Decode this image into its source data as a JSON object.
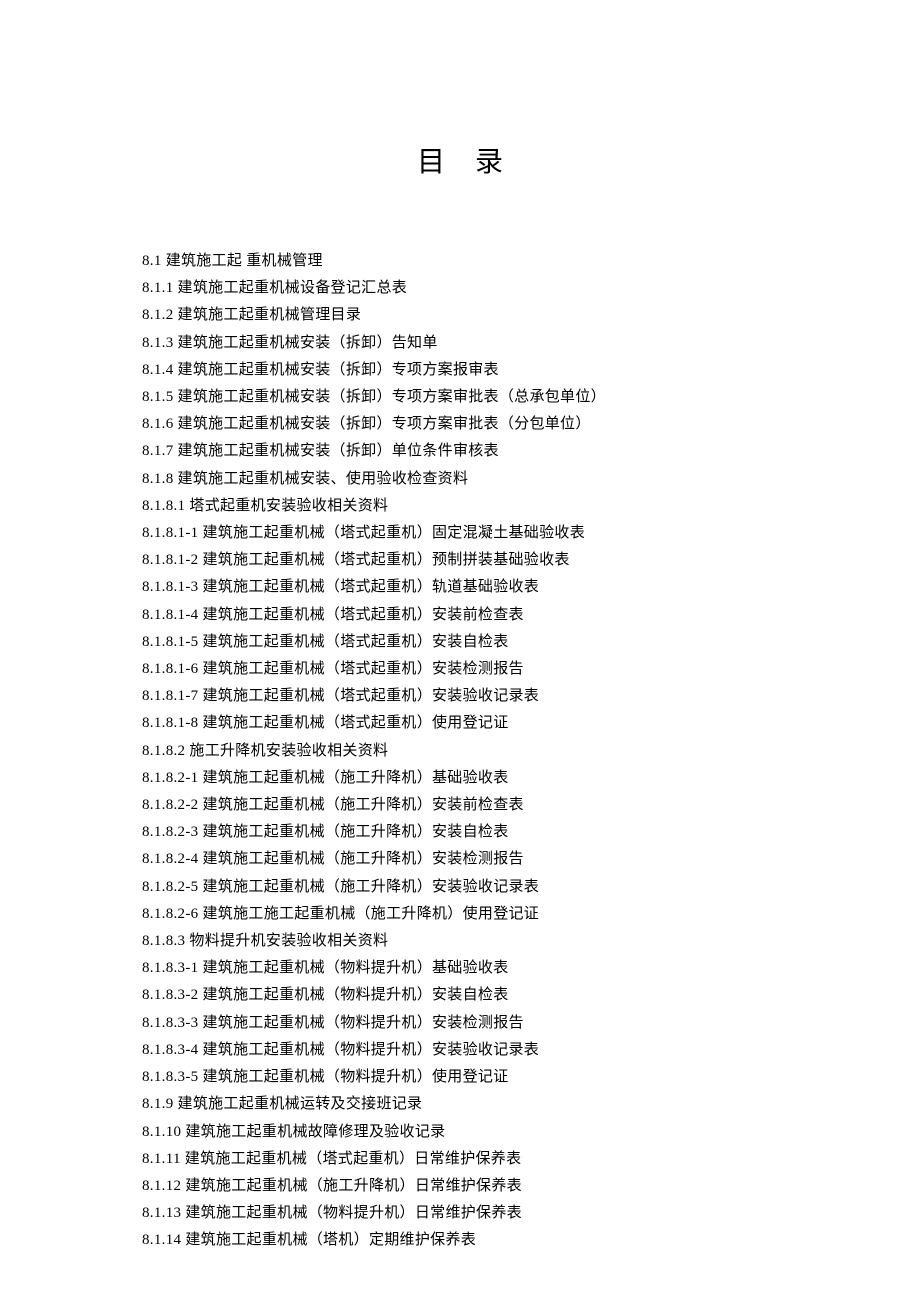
{
  "title": "目录",
  "toc": [
    "8.1  建筑施工起  重机械管理",
    "8.1.1  建筑施工起重机械设备登记汇总表",
    "8.1.2  建筑施工起重机械管理目录",
    "8.1.3  建筑施工起重机械安装（拆卸）告知单",
    "8.1.4  建筑施工起重机械安装（拆卸）专项方案报审表",
    "8.1.5  建筑施工起重机械安装（拆卸）专项方案审批表（总承包单位）",
    "8.1.6  建筑施工起重机械安装（拆卸）专项方案审批表（分包单位）",
    "8.1.7  建筑施工起重机械安装（拆卸）单位条件审核表",
    "8.1.8  建筑施工起重机械安装、使用验收检查资料",
    "8.1.8.1  塔式起重机安装验收相关资料",
    "8.1.8.1-1  建筑施工起重机械（塔式起重机）固定混凝土基础验收表",
    "8.1.8.1-2  建筑施工起重机械（塔式起重机）预制拼装基础验收表",
    "8.1.8.1-3  建筑施工起重机械（塔式起重机）轨道基础验收表",
    "8.1.8.1-4  建筑施工起重机械（塔式起重机）安装前检查表",
    "8.1.8.1-5  建筑施工起重机械（塔式起重机）安装自检表",
    "8.1.8.1-6  建筑施工起重机械（塔式起重机）安装检测报告",
    "8.1.8.1-7  建筑施工起重机械（塔式起重机）安装验收记录表",
    "8.1.8.1-8  建筑施工起重机械（塔式起重机）使用登记证",
    "8.1.8.2  施工升降机安装验收相关资料",
    "8.1.8.2-1  建筑施工起重机械（施工升降机）基础验收表",
    "8.1.8.2-2  建筑施工起重机械（施工升降机）安装前检查表",
    "8.1.8.2-3  建筑施工起重机械（施工升降机）安装自检表",
    "8.1.8.2-4  建筑施工起重机械（施工升降机）安装检测报告",
    "8.1.8.2-5  建筑施工起重机械（施工升降机）安装验收记录表",
    "8.1.8.2-6  建筑施工施工起重机械（施工升降机）使用登记证",
    "8.1.8.3  物料提升机安装验收相关资料",
    "8.1.8.3-1  建筑施工起重机械（物料提升机）基础验收表",
    "8.1.8.3-2  建筑施工起重机械（物料提升机）安装自检表",
    "8.1.8.3-3  建筑施工起重机械（物料提升机）安装检测报告",
    "8.1.8.3-4  建筑施工起重机械（物料提升机）安装验收记录表",
    "8.1.8.3-5  建筑施工起重机械（物料提升机）使用登记证",
    "8.1.9  建筑施工起重机械运转及交接班记录",
    "8.1.10  建筑施工起重机械故障修理及验收记录",
    "8.1.11  建筑施工起重机械（塔式起重机）日常维护保养表",
    "8.1.12  建筑施工起重机械（施工升降机）日常维护保养表",
    "8.1.13  建筑施工起重机械（物料提升机）日常维护保养表",
    "8.1.14  建筑施工起重机械（塔机）定期维护保养表"
  ]
}
